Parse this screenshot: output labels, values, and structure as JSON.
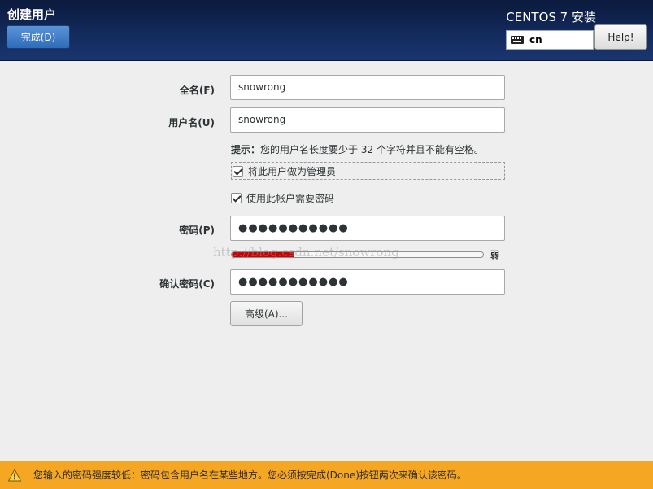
{
  "header": {
    "page_title": "创建用户",
    "done_label": "完成(D)",
    "product_title": "CENTOS 7 安装",
    "keyboard_layout": "cn",
    "help_label": "Help!"
  },
  "form": {
    "fullname_label": "全名(F)",
    "fullname_value": "snowrong",
    "username_label": "用户名(U)",
    "username_value": "snowrong",
    "hint_prefix": "提示：",
    "hint_text": "您的用户名长度要少于 32 个字符并且不能有空格。",
    "admin_checkbox_label": "将此用户做为管理员",
    "admin_checked": true,
    "require_password_label": "使用此帐户需要密码",
    "require_password_checked": true,
    "password_label": "密码(P)",
    "password_value": "●●●●●●●●●●●",
    "strength_level": 0.25,
    "strength_label": "弱",
    "confirm_label": "确认密码(C)",
    "confirm_value": "●●●●●●●●●●●",
    "advanced_label": "高级(A)..."
  },
  "watermark": "http://blog.csdn.net/snowrong",
  "warning": {
    "icon": "warning-icon",
    "text": "您输入的密码强度较低：密码包含用户名在某些地方。您必须按完成(Done)按钮两次来确认该密码。"
  },
  "colors": {
    "header_bg": "#132a5b",
    "done_button": "#3d7cc9",
    "strength_fill": "#cc0000",
    "warning_bar": "#f5a623"
  }
}
